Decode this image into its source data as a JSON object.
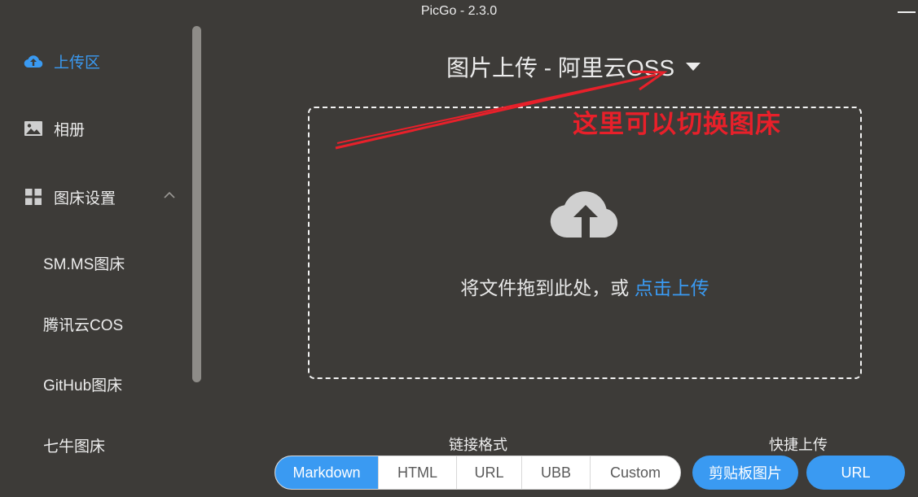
{
  "window": {
    "title": "PicGo - 2.3.0"
  },
  "sidebar": {
    "items": [
      {
        "label": "上传区",
        "icon": "cloud-upload-icon",
        "active": true
      },
      {
        "label": "相册",
        "icon": "image-icon",
        "active": false
      },
      {
        "label": "图床设置",
        "icon": "grid-icon",
        "active": false
      }
    ],
    "sub_items": [
      "SM.MS图床",
      "腾讯云COS",
      "GitHub图床",
      "七牛图床"
    ]
  },
  "main": {
    "heading": "图片上传 - 阿里云OSS",
    "drop_text": "将文件拖到此处，或 ",
    "drop_link": "点击上传",
    "annotation": "这里可以切换图床",
    "link_format": {
      "label": "链接格式",
      "options": [
        "Markdown",
        "HTML",
        "URL",
        "UBB",
        "Custom"
      ],
      "selected": "Markdown"
    },
    "quick_upload": {
      "label": "快捷上传",
      "buttons": [
        "剪贴板图片",
        "URL"
      ]
    }
  },
  "colors": {
    "accent": "#3a9af2",
    "background": "#3d3b38",
    "annotation": "#e8202a"
  }
}
